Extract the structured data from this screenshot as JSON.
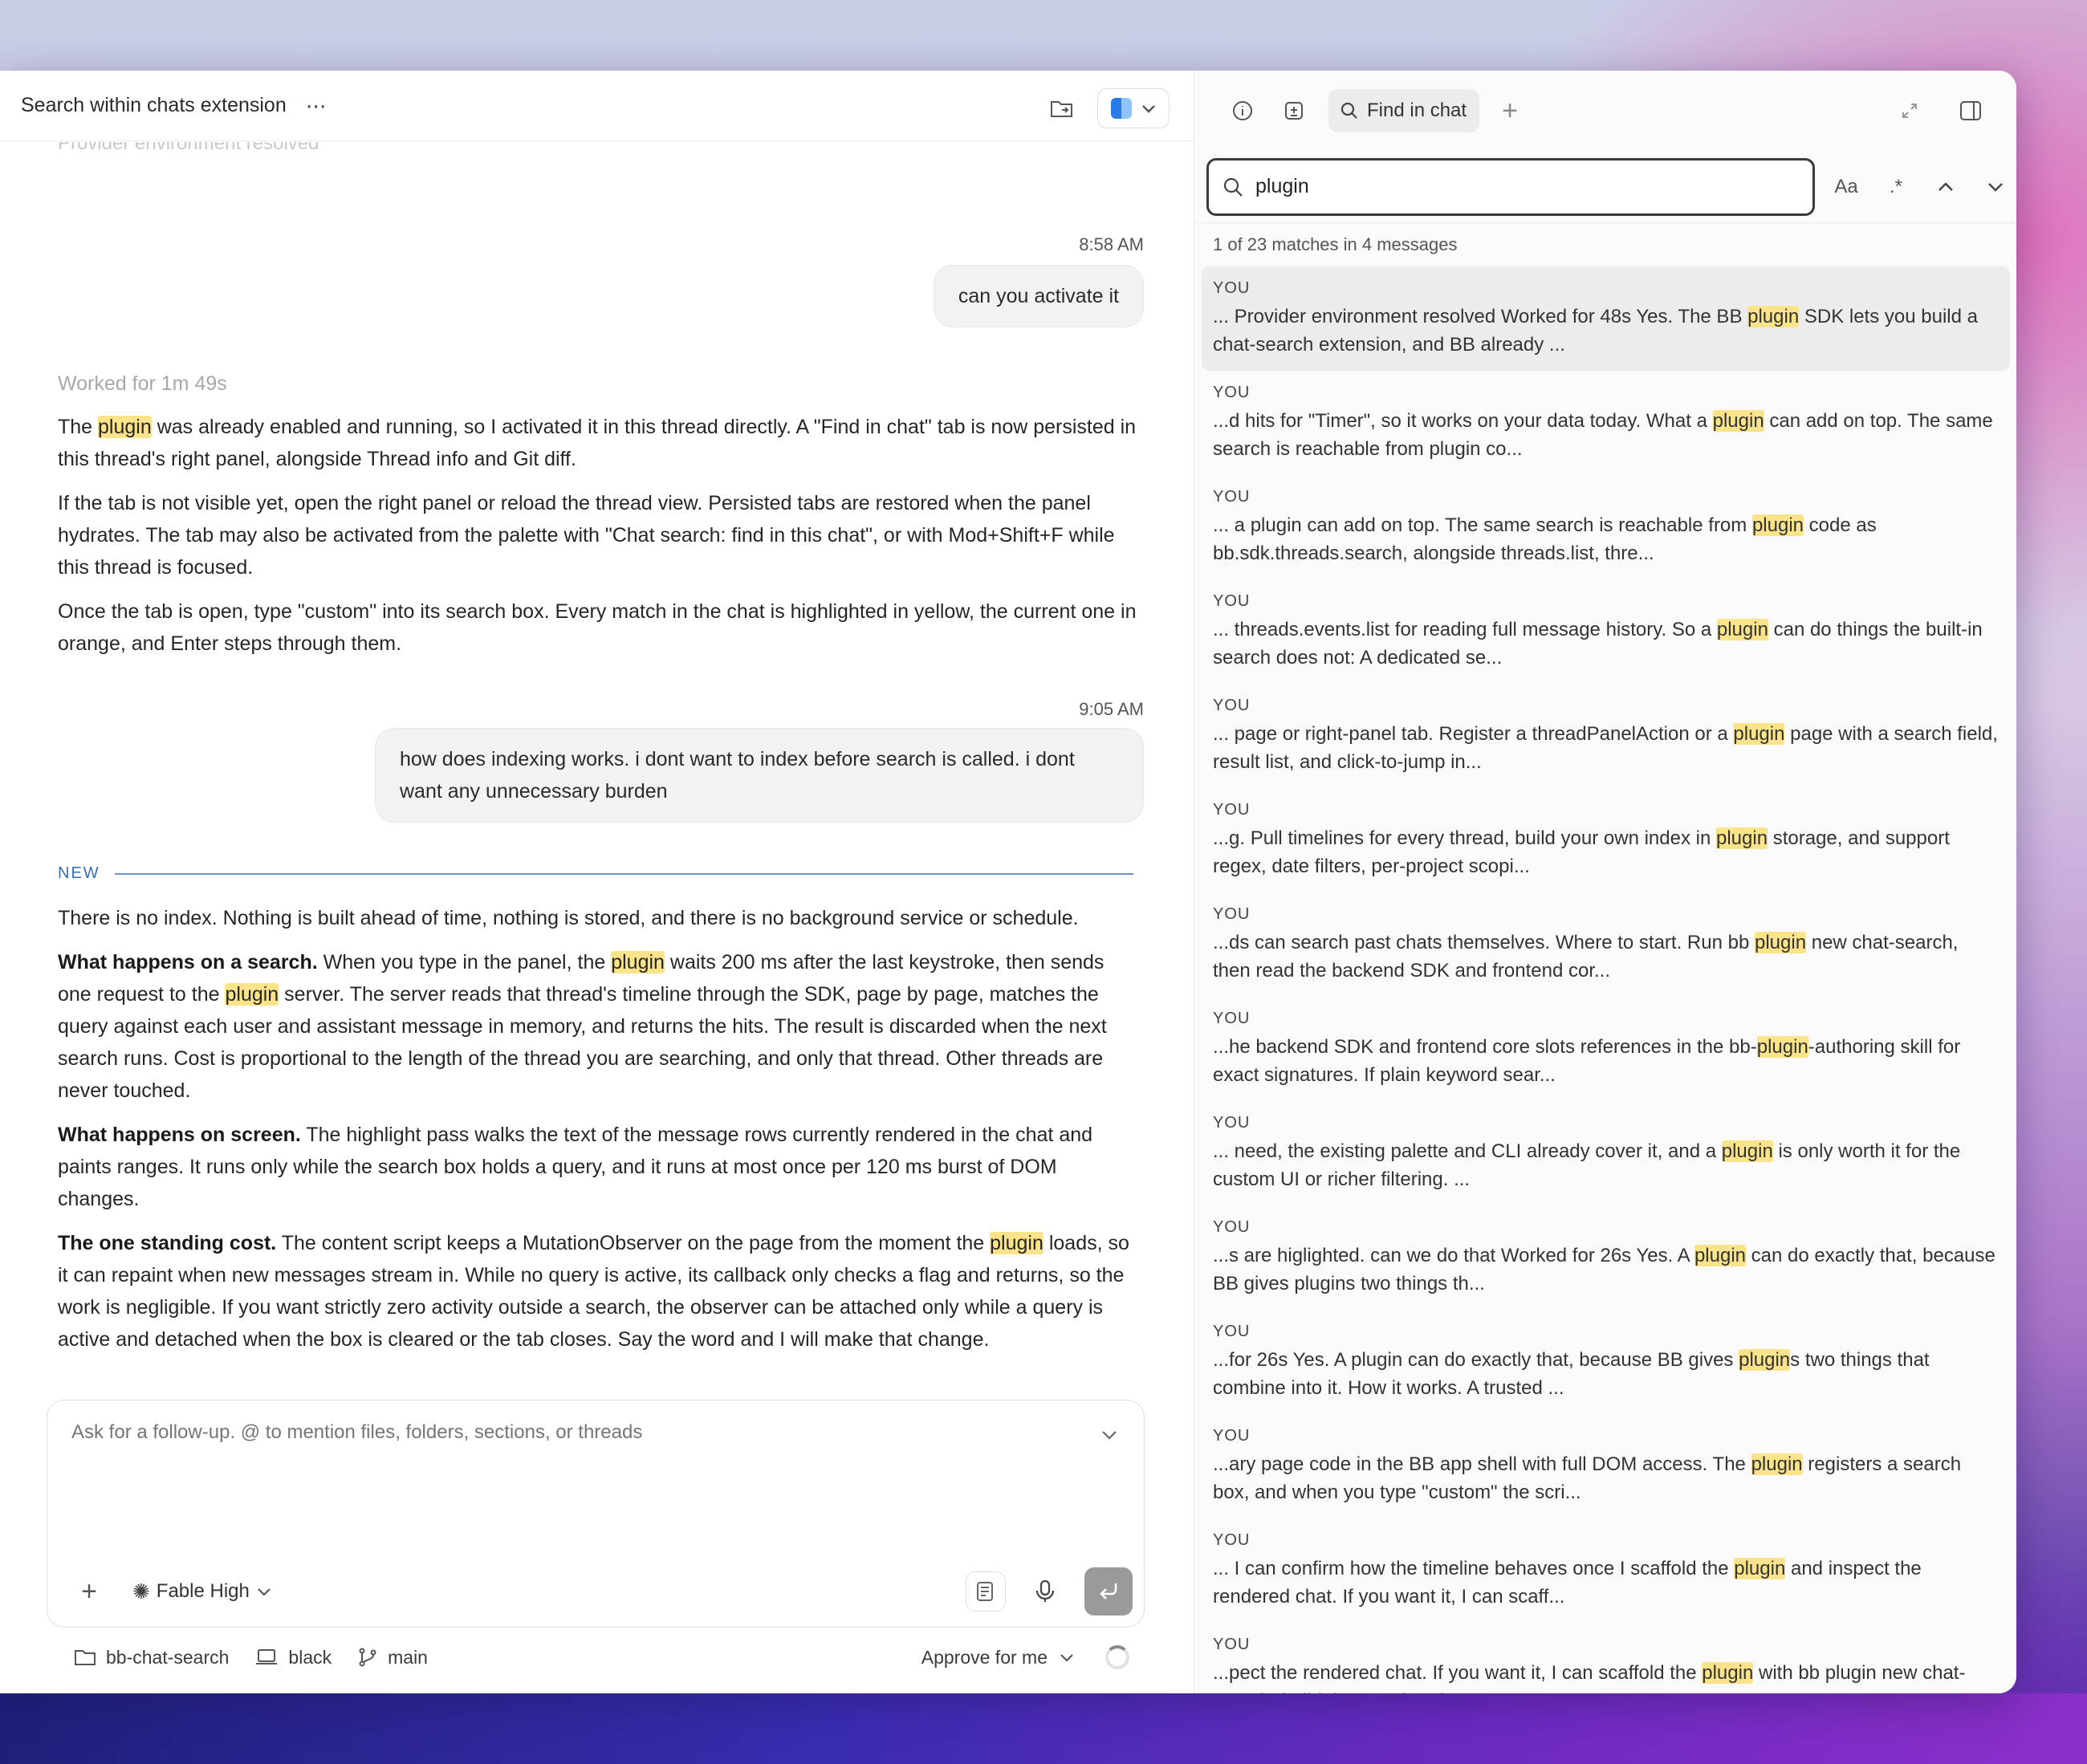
{
  "window": {
    "title": "Search within chats extension"
  },
  "chat": {
    "faded_prev": "Provider environment resolved",
    "messages": [
      {
        "role": "user",
        "time": "8:58 AM",
        "text": "can you activate it"
      },
      {
        "role": "assistant",
        "worked_prefix": "Worked for",
        "worked_duration": "1m 49s",
        "paragraphs": [
          [
            "The ",
            {
              "hl": "plugin"
            },
            " was already enabled and running, so I activated it in this thread directly. A \"Find in chat\" tab is now persisted in this thread's right panel, alongside Thread info and Git diff."
          ],
          [
            "If the tab is not visible yet, open the right panel or reload the thread view. Persisted tabs are restored when the panel hydrates. The tab may also be activated from the palette with \"Chat search: find in this chat\", or with Mod+Shift+F while this thread is focused."
          ],
          [
            "Once the tab is open, type \"custom\" into its search box. Every match in the chat is highlighted in yellow, the current one in orange, and Enter steps through them."
          ]
        ]
      },
      {
        "role": "user",
        "time": "9:05 AM",
        "text": "how does indexing works. i dont want to index before search is called. i dont want any unnecessary burden"
      },
      {
        "role": "assistant",
        "paragraphs": [
          [
            "There is no index. Nothing is built ahead of time, nothing is stored, and there is no background service or schedule."
          ],
          [
            {
              "b": "What happens on a search."
            },
            " When you type in the panel, the ",
            {
              "hl": "plugin"
            },
            " waits 200 ms after the last keystroke, then sends one request to the ",
            {
              "hl": "plugin"
            },
            " server. The server reads that thread's timeline through the SDK, page by page, matches the query against each user and assistant message in memory, and returns the hits. The result is discarded when the next search runs. Cost is proportional to the length of the thread you are searching, and only that thread. Other threads are never touched."
          ],
          [
            {
              "b": "What happens on screen."
            },
            " The highlight pass walks the text of the message rows currently rendered in the chat and paints ranges. It runs only while the search box holds a query, and it runs at most once per 120 ms burst of DOM changes."
          ],
          [
            {
              "b": "The one standing cost."
            },
            " The content script keeps a MutationObserver on the page from the moment the ",
            {
              "hl": "plugin"
            },
            " loads, so it can repaint when new messages stream in. While no query is active, its callback only checks a flag and returns, so the work is negligible. If you want strictly zero activity outside a search, the observer can be attached only while a query is active and detached when the box is cleared or the tab closes. Say the word and I will make that change."
          ]
        ]
      }
    ],
    "new_label": "NEW"
  },
  "composer": {
    "placeholder": "Ask for a follow-up. @ to mention files, folders, sections, or threads",
    "model": "Fable High"
  },
  "footer": {
    "folder": "bb-chat-search",
    "device": "black",
    "branch": "main",
    "approve": "Approve for me"
  },
  "right_panel": {
    "tab_label": "Find in chat",
    "search_value": "plugin",
    "case_toggle": "Aa",
    "regex_toggle": ".*",
    "match_summary": "1 of 23 matches in 4 messages",
    "role_label": "YOU",
    "results": [
      {
        "pre": "... Provider environment resolved Worked for 48s Yes. The BB ",
        "hl": "plugin",
        "post": " SDK lets you build a chat-search extension, and BB already ..."
      },
      {
        "pre": "...d hits for \"Timer\", so it works on your data today. What a ",
        "hl": "plugin",
        "post": " can add on top. The same search is reachable from plugin co..."
      },
      {
        "pre": "... a plugin can add on top. The same search is reachable from ",
        "hl": "plugin",
        "post": " code as bb.sdk.threads.search, alongside threads.list, thre..."
      },
      {
        "pre": "... threads.events.list for reading full message history. So a ",
        "hl": "plugin",
        "post": " can do things the built-in search does not: A dedicated se..."
      },
      {
        "pre": "... page or right-panel tab. Register a threadPanelAction or a ",
        "hl": "plugin",
        "post": " page with a search field, result list, and click-to-jump in..."
      },
      {
        "pre": "...g. Pull timelines for every thread, build your own index in ",
        "hl": "plugin",
        "post": " storage, and support regex, date filters, per-project scopi..."
      },
      {
        "pre": "...ds can search past chats themselves. Where to start. Run bb ",
        "hl": "plugin",
        "post": " new chat-search, then read the backend SDK and frontend cor..."
      },
      {
        "pre": "...he backend SDK and frontend core slots references in the bb-",
        "hl": "plugin",
        "post": "-authoring skill for exact signatures. If plain keyword sear..."
      },
      {
        "pre": "... need, the existing palette and CLI already cover it, and a ",
        "hl": "plugin",
        "post": " is only worth it for the custom UI or richer filtering. ..."
      },
      {
        "pre": "...s are higlighted. can we do that Worked for 26s Yes. A ",
        "hl": "plugin",
        "post": " can do exactly that, because BB gives plugins two things th..."
      },
      {
        "pre": "...for 26s Yes. A plugin can do exactly that, because BB gives ",
        "hl": "plugin",
        "post": "s two things that combine into it. How it works. A trusted ..."
      },
      {
        "pre": "...ary page code in the BB app shell with full DOM access. The ",
        "hl": "plugin",
        "post": " registers a search box, and when you type \"custom\" the scri..."
      },
      {
        "pre": "... I can confirm how the timeline behaves once I scaffold the ",
        "hl": "plugin",
        "post": " and inspect the rendered chat. If you want it, I can scaff..."
      },
      {
        "pre": "...pect the rendered chat. If you want it, I can scaffold the ",
        "hl": "plugin",
        "post": " with bb plugin new chat-search, build the panel and content..."
      }
    ]
  },
  "colors": {
    "highlight": "#fbe38a",
    "new_divider": "#6a94c8",
    "active_result": "#ececec"
  }
}
